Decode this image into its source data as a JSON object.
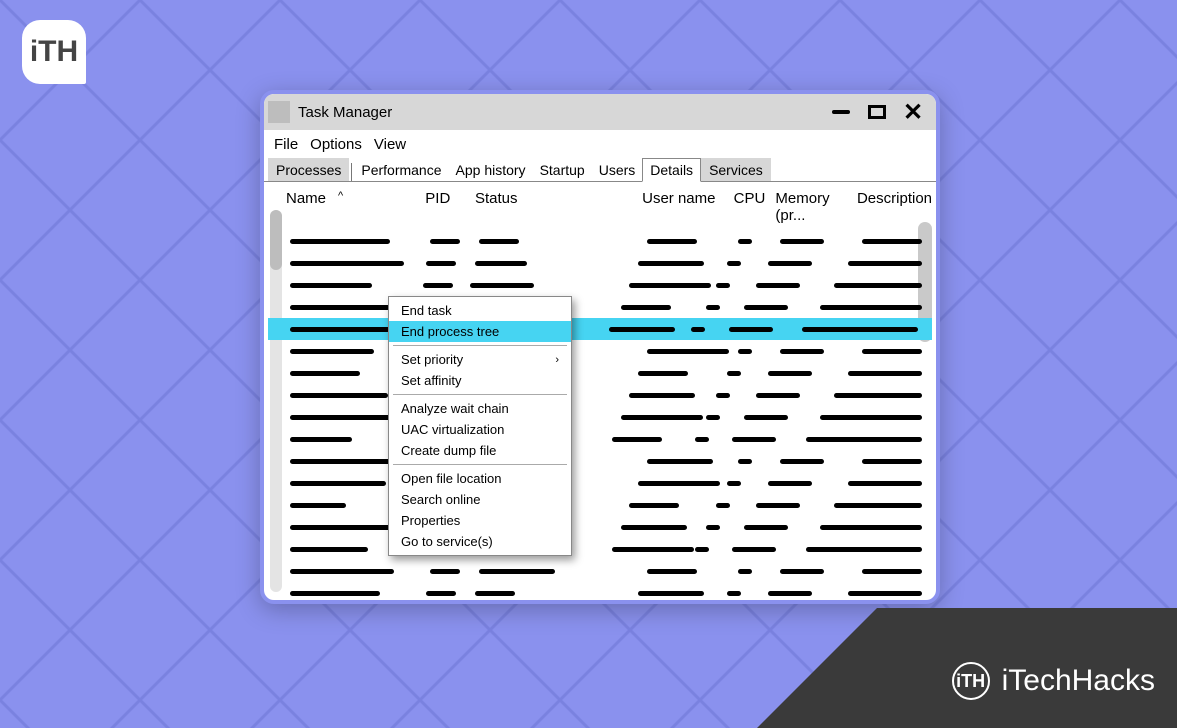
{
  "brand": {
    "tl_logo_text": "iTH",
    "ribbon_text": "iTechHacks",
    "ribbon_logo_text": "iTH"
  },
  "window": {
    "title": "Task Manager",
    "controls": {
      "minimize": "minimize",
      "maximize": "maximize",
      "close": "close"
    }
  },
  "menubar": [
    "File",
    "Options",
    "View"
  ],
  "tabs": [
    {
      "label": "Processes",
      "active": false,
      "group": "shaded"
    },
    {
      "label": "Performance",
      "active": false,
      "group": "plain"
    },
    {
      "label": "App history",
      "active": false,
      "group": "plain"
    },
    {
      "label": "Startup",
      "active": false,
      "group": "plain"
    },
    {
      "label": "Users",
      "active": false,
      "group": "plain"
    },
    {
      "label": "Details",
      "active": true,
      "group": "active"
    },
    {
      "label": "Services",
      "active": false,
      "group": "shaded2"
    }
  ],
  "columns": {
    "name": "Name",
    "pid": "PID",
    "status": "Status",
    "user": "User name",
    "cpu": "CPU",
    "memory": "Memory (pr...",
    "description": "Description",
    "sort_indicator": "^"
  },
  "context_menu": {
    "items": [
      {
        "label": "End task",
        "highlighted": false
      },
      {
        "label": "End process tree",
        "highlighted": true
      },
      {
        "sep": true
      },
      {
        "label": "Set priority",
        "submenu": true
      },
      {
        "label": "Set affinity"
      },
      {
        "sep": true
      },
      {
        "label": "Analyze wait chain"
      },
      {
        "label": "UAC virtualization"
      },
      {
        "label": "Create dump file"
      },
      {
        "sep": true
      },
      {
        "label": "Open file location"
      },
      {
        "label": "Search online"
      },
      {
        "label": "Properties"
      },
      {
        "label": "Go to service(s)"
      }
    ],
    "arrow": "›"
  },
  "selected_row_index": 4,
  "row_count": 18
}
